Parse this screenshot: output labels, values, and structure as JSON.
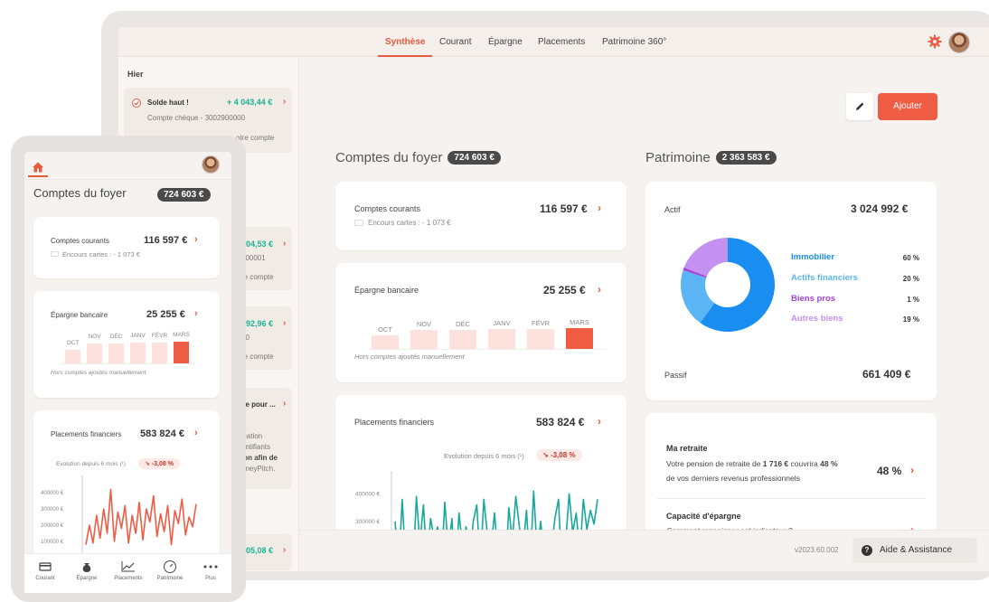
{
  "nav": {
    "tabs": [
      {
        "label": "Synthèse",
        "active": true
      },
      {
        "label": "Courant"
      },
      {
        "label": "Épargne"
      },
      {
        "label": "Placements"
      },
      {
        "label": "Patrimoine 360°"
      }
    ]
  },
  "feed": {
    "day_label": "Hier",
    "items": [
      {
        "title": "Solde haut !",
        "amount": "+ 4 043,44 €",
        "sub": "Compte chèque - 3002900000",
        "sub2": "otre compte"
      },
      {
        "amount": "004,53 €",
        "sub": "900001",
        "sub2": "re compte"
      },
      {
        "amount": "792,96 €",
        "sub": "00",
        "sub2": "re compte"
      },
      {
        "title": "se pour ...",
        "lines": [
          "ication",
          "entifiants",
          "ion afin de",
          "oneyPitch."
        ]
      },
      {
        "amount": "305,08 €"
      }
    ]
  },
  "actions": {
    "add_label": "Ajouter"
  },
  "comptes": {
    "title": "Comptes du foyer",
    "total": "724 603 €",
    "courants": {
      "label": "Comptes courants",
      "value": "116 597 €",
      "sub": "Encours cartes : - 1 073 €"
    },
    "epargne": {
      "label": "Épargne bancaire",
      "value": "25 255 €",
      "note": "Hors comptes ajoutés manuellement"
    },
    "placements": {
      "label": "Placements financiers",
      "value": "583 824 €",
      "evo_label": "Evolution depuis 6 mois (¹)",
      "evo_value": "-3,08 %"
    }
  },
  "patrimoine": {
    "title": "Patrimoine",
    "total": "2 363 583 €",
    "actif_label": "Actif",
    "actif_value": "3 024 992 €",
    "passif_label": "Passif",
    "passif_value": "661 409 €"
  },
  "retraite": {
    "title": "Ma retraite",
    "text_a": "Votre pension de retraite de ",
    "text_b": "1 716 €",
    "text_c": " couvrira ",
    "text_d": "48 %",
    "text_e": "de vos derniers revenus professionnels",
    "value": "48 %",
    "capacite_title": "Capacité d'épargne",
    "capacite_sub": "Comment renseigner cet indicateur ?"
  },
  "footer": {
    "version": "v2023.60.002",
    "help_label": "Aide & Assistance"
  },
  "mobile": {
    "title": "Comptes du foyer",
    "total": "724 603 €",
    "nav": [
      {
        "label": "Courant",
        "icon": "card-icon"
      },
      {
        "label": "Épargne",
        "icon": "money-bag-icon"
      },
      {
        "label": "Placements",
        "icon": "chart-line-icon"
      },
      {
        "label": "Patrimoine",
        "icon": "gauge-icon"
      },
      {
        "label": "Plus",
        "icon": "more-icon"
      }
    ]
  },
  "colors": {
    "accent": "#ef5c44",
    "positive": "#1ab394"
  },
  "chart_data": [
    {
      "id": "epargne-bars",
      "type": "bar",
      "categories": [
        "OCT",
        "NOV",
        "DÉC",
        "JANV",
        "FÉVR",
        "MARS"
      ],
      "values": [
        24800,
        25120,
        25150,
        25170,
        25200,
        25255
      ],
      "highlight": "MARS",
      "colors": {
        "normal": "#fde1dc",
        "highlight": "#ef5c44"
      }
    },
    {
      "id": "placements-line",
      "type": "line",
      "y_ticks": [
        "400000 €",
        "300000 €",
        "200000 €",
        "100000 €"
      ],
      "ylim": [
        50000,
        450000
      ],
      "values": [
        300000,
        120000,
        380000,
        140000,
        230000,
        100000,
        390000,
        220000,
        360000,
        150000,
        310000,
        240000,
        280000,
        120000,
        370000,
        200000,
        310000,
        100000,
        330000,
        210000,
        280000,
        160000,
        300000,
        360000,
        140000,
        380000,
        250000,
        200000,
        330000,
        170000,
        250000,
        90000,
        350000,
        230000,
        390000,
        280000,
        200000,
        340000,
        120000,
        410000,
        190000,
        300000,
        150000,
        260000,
        200000,
        310000,
        380000,
        100000,
        220000,
        400000,
        260000,
        330000,
        180000,
        380000,
        270000,
        340000,
        290000,
        380000
      ],
      "color": "#17a89b"
    },
    {
      "id": "patrimoine-donut",
      "type": "pie",
      "slices": [
        {
          "name": "Immobilier",
          "pct": "60 %",
          "value": 60,
          "color": "#1a8ef0"
        },
        {
          "name": "Actifs financiers",
          "pct": "20 %",
          "value": 20,
          "color": "#5bb5f5"
        },
        {
          "name": "Biens pros",
          "pct": "1 %",
          "value": 1,
          "color": "#a544d6"
        },
        {
          "name": "Autres biens",
          "pct": "19 %",
          "value": 19,
          "color": "#c591f0"
        }
      ]
    },
    {
      "id": "mobile-placements-line",
      "type": "line",
      "y_ticks": [
        "400000 €",
        "300000 €",
        "200000 €",
        "100000 €"
      ],
      "ylim": [
        50000,
        450000
      ],
      "values": [
        80000,
        200000,
        90000,
        260000,
        120000,
        300000,
        150000,
        420000,
        100000,
        280000,
        180000,
        320000,
        90000,
        260000,
        150000,
        340000,
        110000,
        300000,
        220000,
        380000,
        130000,
        270000,
        160000,
        320000,
        80000,
        290000,
        210000,
        360000,
        140000,
        250000,
        190000,
        330000
      ],
      "color": "#ef5c44"
    }
  ]
}
